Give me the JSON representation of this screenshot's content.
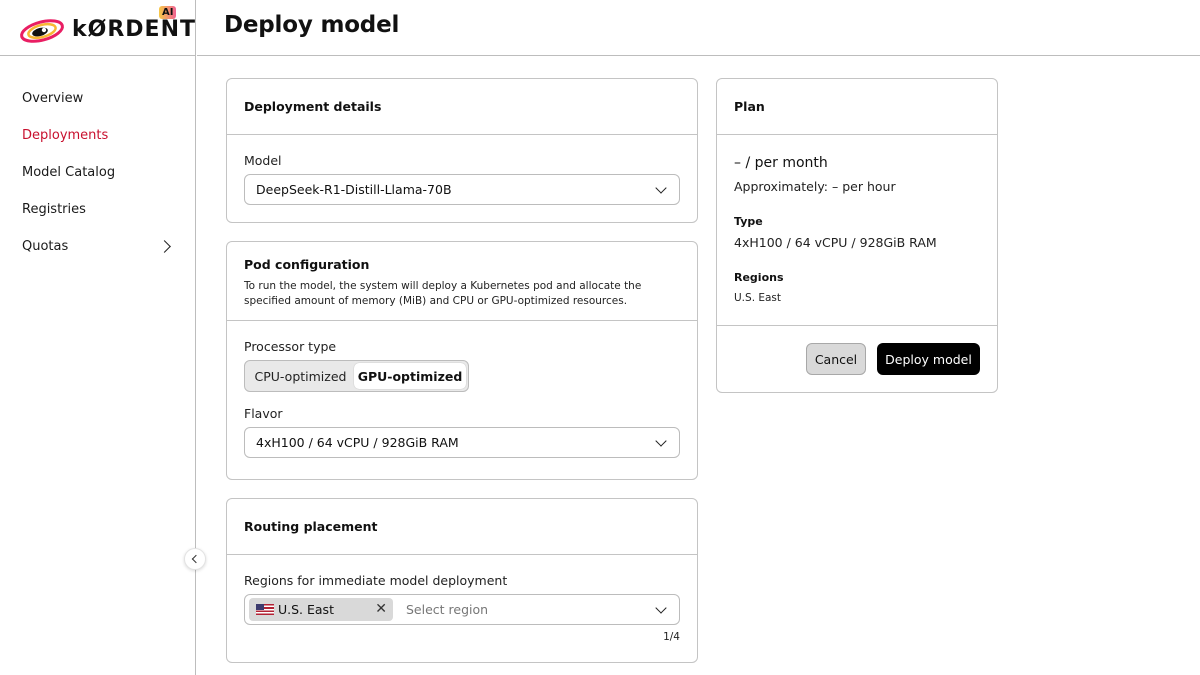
{
  "brand": {
    "name": "kØRDENT",
    "badge": "AI"
  },
  "sidebar": {
    "items": [
      {
        "label": "Overview"
      },
      {
        "label": "Deployments"
      },
      {
        "label": "Model Catalog"
      },
      {
        "label": "Registries"
      },
      {
        "label": "Quotas"
      }
    ]
  },
  "header": {
    "title": "Deploy model"
  },
  "deployment_details": {
    "title": "Deployment details",
    "model_label": "Model",
    "model_value": "DeepSeek-R1-Distill-Llama-70B"
  },
  "pod_config": {
    "title": "Pod configuration",
    "description_line1": "To run the model, the system will deploy a Kubernetes pod and allocate the",
    "description_line2": "specified amount of memory (MiB) and CPU or GPU-optimized resources.",
    "processor_label": "Processor type",
    "processor_options": [
      "CPU-optimized",
      "GPU-optimized"
    ],
    "processor_selected": "GPU-optimized",
    "flavor_label": "Flavor",
    "flavor_value": "4xH100 / 64 vCPU / 928GiB RAM"
  },
  "routing": {
    "title": "Routing placement",
    "regions_label": "Regions for immediate model deployment",
    "selected_region": "U.S. East",
    "placeholder": "Select region",
    "count": "1/4"
  },
  "plan": {
    "title": "Plan",
    "price_month": "– / per month",
    "price_hour": "Approximately: – per hour",
    "type_label": "Type",
    "type_value": "4xH100 / 64 vCPU / 928GiB RAM",
    "regions_label": "Regions",
    "regions_value": "U.S. East",
    "cancel_label": "Cancel",
    "deploy_label": "Deploy model"
  },
  "colors": {
    "accent": "#c8102e",
    "primary_button": "#000000",
    "border": "#c4c4c4"
  }
}
